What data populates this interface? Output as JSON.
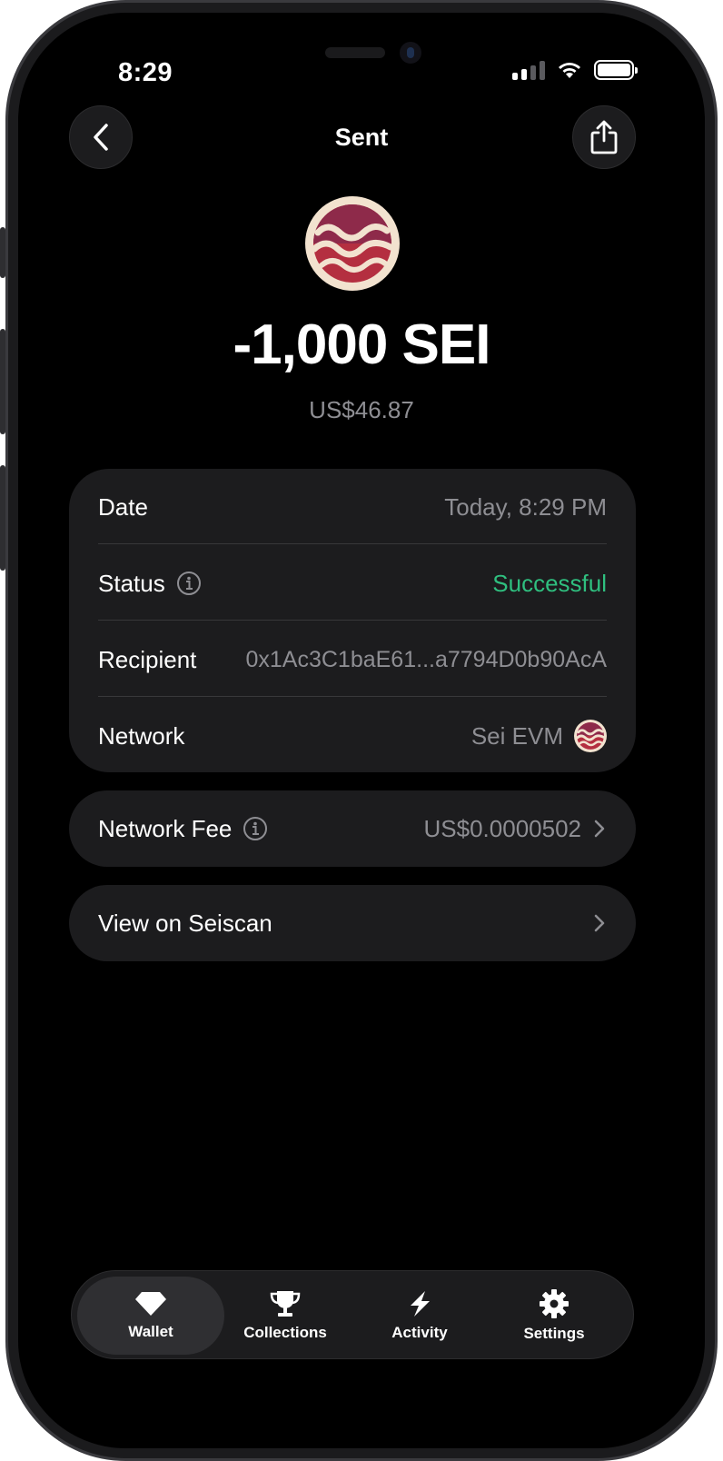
{
  "status_bar": {
    "time": "8:29"
  },
  "header": {
    "title": "Sent"
  },
  "transaction": {
    "amount": "-1,000 SEI",
    "fiat_value": "US$46.87"
  },
  "details": {
    "date_label": "Date",
    "date_value": "Today, 8:29 PM",
    "status_label": "Status",
    "status_value": "Successful",
    "status_color": "#2fbf7f",
    "recipient_label": "Recipient",
    "recipient_value": "0x1Ac3C1baE61...a7794D0b90AcA",
    "network_label": "Network",
    "network_value": "Sei EVM"
  },
  "fee": {
    "label": "Network Fee",
    "value": "US$0.0000502"
  },
  "explorer": {
    "label": "View on Seiscan"
  },
  "tabbar": {
    "tabs": [
      {
        "label": "Wallet",
        "icon": "diamond-icon",
        "active": true
      },
      {
        "label": "Collections",
        "icon": "trophy-icon",
        "active": false
      },
      {
        "label": "Activity",
        "icon": "lightning-icon",
        "active": false
      },
      {
        "label": "Settings",
        "icon": "gear-icon",
        "active": false
      }
    ]
  },
  "colors": {
    "background": "#000000",
    "card": "#1c1c1e",
    "secondary_text": "#8e8e93",
    "accent_success": "#2fbf7f"
  }
}
